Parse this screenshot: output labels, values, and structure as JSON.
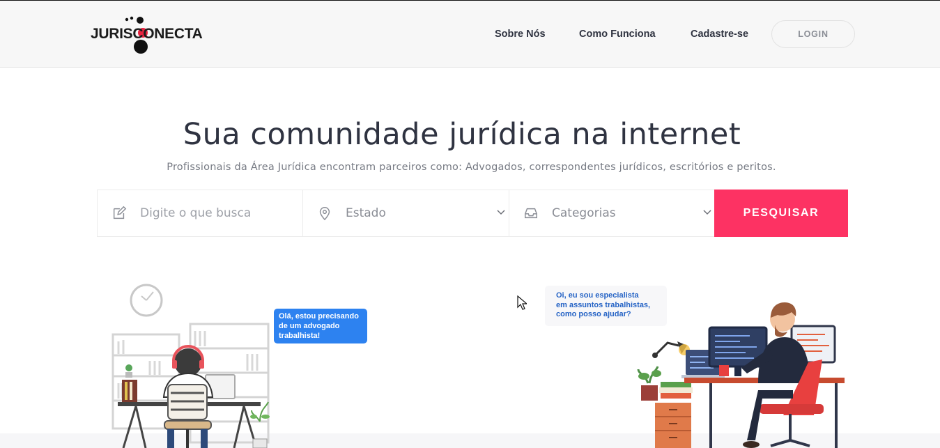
{
  "header": {
    "logo_text": "JURISCONECTA",
    "nav": [
      "Sobre Nós",
      "Como Funciona",
      "Cadastre-se"
    ],
    "login_label": "LOGIN"
  },
  "hero": {
    "title": "Sua comunidade jurídica na internet",
    "subtitle": "Profissionais da Área Jurídica encontram parceiros como: Advogados, correspondentes jurídicos, escritórios e peritos."
  },
  "search": {
    "query_placeholder": "Digite o que busca",
    "state_value": "Estado",
    "category_value": "Categorias",
    "button_label": "PESQUISAR"
  },
  "bubbles": {
    "left": [
      "Olá, estou precisando",
      "de um advogado",
      "trabalhista!"
    ],
    "right": [
      "Oi, eu sou especialista",
      "em assuntos trabalhistas,",
      "como posso ajudar?"
    ]
  },
  "colors": {
    "accent": "#fd3263",
    "bubble_blue": "#2d82f0",
    "text_dark": "#2f3341"
  },
  "icons": {
    "query": "edit-icon",
    "state": "map-pin-icon",
    "category": "inbox-icon",
    "chevron": "chevron-down-icon"
  }
}
